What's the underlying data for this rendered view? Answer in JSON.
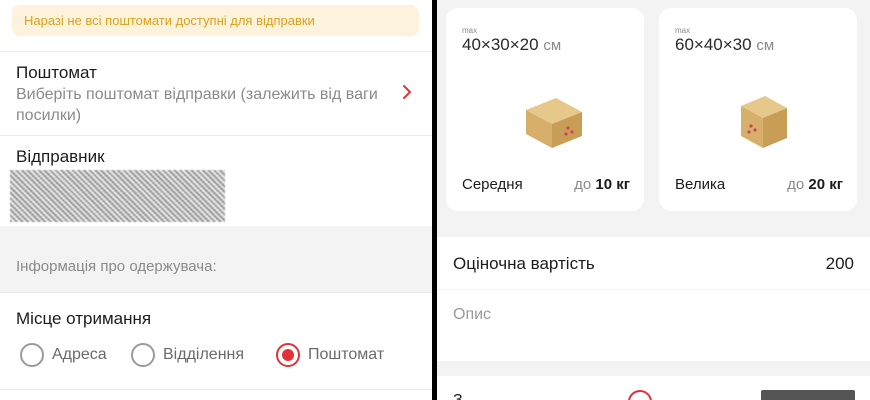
{
  "left": {
    "warning": "Наразі не всі поштомати доступні для відправки",
    "locker": {
      "title": "Поштомат",
      "subtitle": "Виберіть поштомат відправки (залежить від ваги посилки)"
    },
    "sender": {
      "title": "Відправник"
    },
    "recipient_info_label": "Інформація про одержувача:",
    "receive_place": {
      "title": "Місце отримання",
      "options": [
        {
          "label": "Адреса",
          "selected": false
        },
        {
          "label": "Відділення",
          "selected": false
        },
        {
          "label": "Поштомат",
          "selected": true
        }
      ]
    }
  },
  "right": {
    "sizes": [
      {
        "max": "max",
        "dims": "40×30×20",
        "unit": "см",
        "name": "Середня",
        "weight_prefix": "до",
        "weight": "10 кг"
      },
      {
        "max": "max",
        "dims": "60×40×30",
        "unit": "см",
        "name": "Велика",
        "weight_prefix": "до",
        "weight": "20 кг"
      }
    ],
    "estimated_value": {
      "label": "Оціночна вартість",
      "value": "200"
    },
    "description": {
      "placeholder": "Опис"
    }
  },
  "colors": {
    "accent": "#e1323a",
    "warning_bg": "#fdf3dc",
    "warning_text": "#d9a21a"
  }
}
